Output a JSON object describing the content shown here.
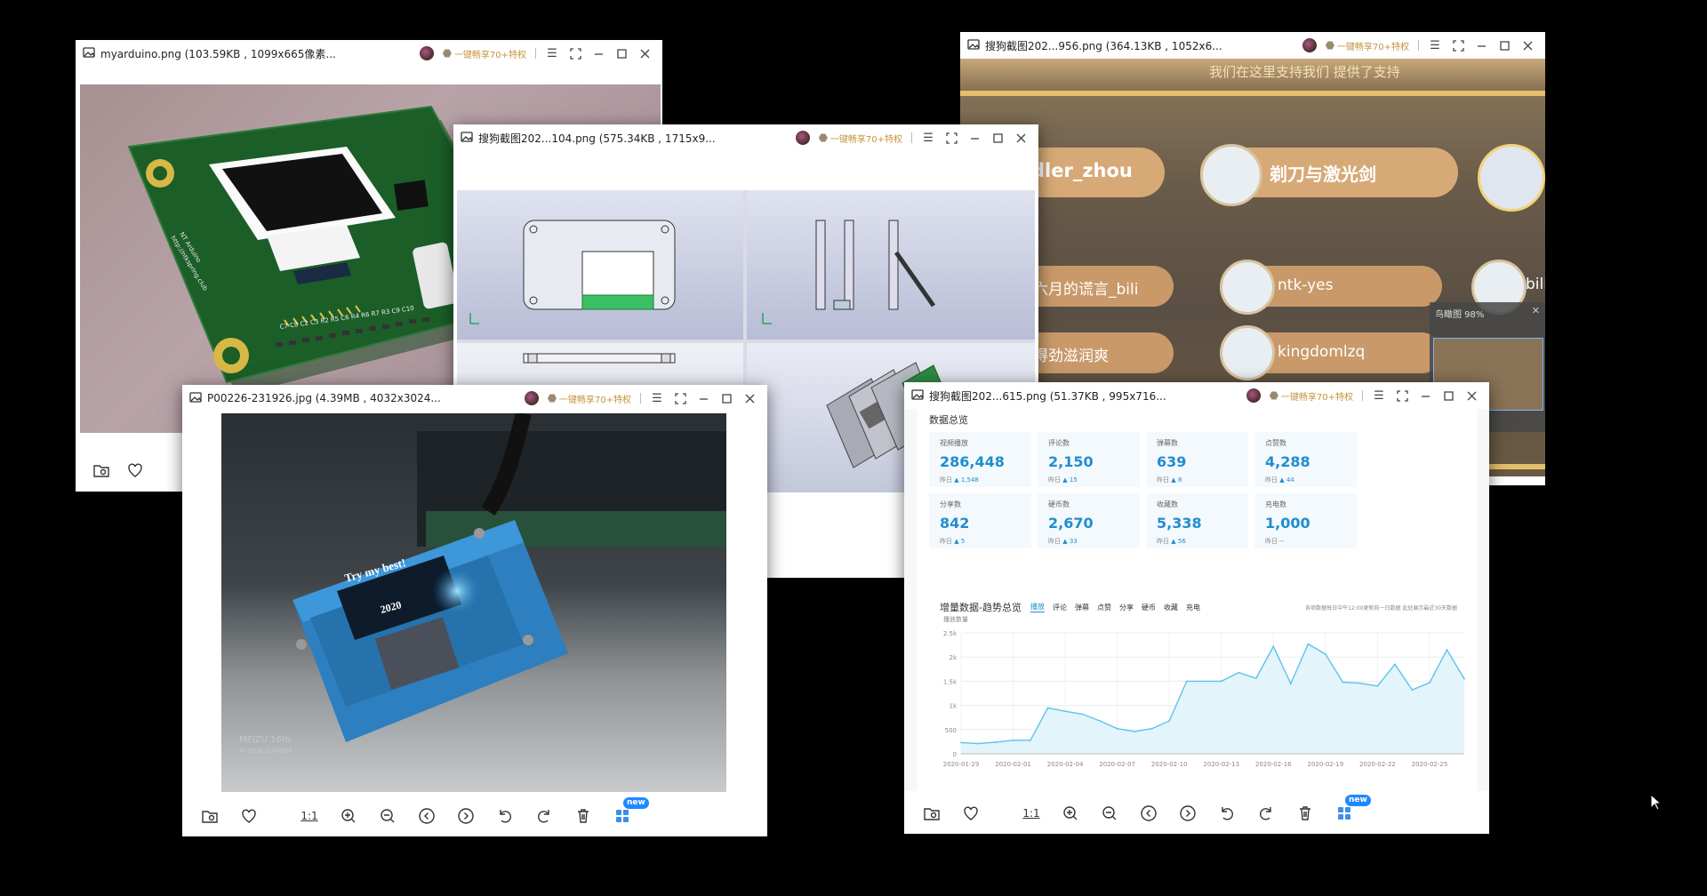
{
  "windows": {
    "w1": {
      "title": "myarduino.png (103.59KB , 1099x665像素..."
    },
    "w2": {
      "title": "搜狗截图202...104.png (575.34KB , 1715x9..."
    },
    "w3": {
      "title": "搜狗截图202...956.png (364.13KB , 1052x6..."
    },
    "w4": {
      "title": "P00226-231926.jpg (4.39MB , 4032x3024..."
    },
    "w5": {
      "title": "搜狗截图202...615.png (51.37KB , 995x716..."
    }
  },
  "promo_label": "一键畅享70+特权",
  "zoom_ratio_label": "1:1",
  "new_badge": "new",
  "pcb": {
    "brand_line1": "NT Arduino",
    "brand_line2": "http://ntkspring.club",
    "labels_row": "C7 C8 C2 C3 R2 R5 C6 R4 R6 R7 R3 C9 C10"
  },
  "photo_text": {
    "screen_line1": "Try my best!",
    "screen_line2": "2020",
    "watermark_line1": "MEIZU 16th",
    "watermark_line2": "AI DUAL CAMERA"
  },
  "bili": {
    "top_text": "我们在这里支持我们 提供了支持",
    "names": [
      "dler_zhou",
      "剃刀与激光剑",
      "六月的谎言_bili",
      "ntk-yes",
      "bili",
      "得劲滋润爽",
      "kingdomlzq"
    ],
    "minimap_label": "鸟瞰图 98%"
  },
  "dashboard": {
    "title": "数据总览",
    "cards": [
      {
        "label": "视频播放",
        "value": "286,448",
        "yesterday": "昨日",
        "delta": "▲ 1,548"
      },
      {
        "label": "评论数",
        "value": "2,150",
        "yesterday": "昨日",
        "delta": "▲ 15"
      },
      {
        "label": "弹幕数",
        "value": "639",
        "yesterday": "昨日",
        "delta": "▲ 8"
      },
      {
        "label": "点赞数",
        "value": "4,288",
        "yesterday": "昨日",
        "delta": "▲ 44"
      },
      {
        "label": "分享数",
        "value": "842",
        "yesterday": "昨日",
        "delta": "▲ 5"
      },
      {
        "label": "硬币数",
        "value": "2,670",
        "yesterday": "昨日",
        "delta": "▲ 33"
      },
      {
        "label": "收藏数",
        "value": "5,338",
        "yesterday": "昨日",
        "delta": "▲ 56"
      },
      {
        "label": "充电数",
        "value": "1,000",
        "yesterday": "昨日",
        "delta": "--"
      }
    ],
    "trend_title": "增量数据-趋势总览",
    "tabs": [
      "播放",
      "评论",
      "弹幕",
      "点赞",
      "分享",
      "硬币",
      "收藏",
      "充电"
    ],
    "active_tab": 0,
    "note": "各项数据每日中午12:00更新前一日数据   此处展示最近30天数据",
    "ylabel": "播放数量"
  },
  "chart_data": {
    "type": "area",
    "title": "增量数据-趋势总览",
    "ylabel": "播放数量",
    "ylim": [
      0,
      2500
    ],
    "yticks": [
      "0",
      "500",
      "1k",
      "1.5k",
      "2k",
      "2.5k"
    ],
    "ytick_values": [
      0,
      500,
      1000,
      1500,
      2000,
      2500
    ],
    "xtick_labels": [
      "2020-01-29",
      "2020-02-01",
      "2020-02-04",
      "2020-02-07",
      "2020-02-10",
      "2020-02-13",
      "2020-02-16",
      "2020-02-19",
      "2020-02-22",
      "2020-02-25"
    ],
    "series": [
      {
        "values": [
          230,
          210,
          240,
          280,
          280,
          950,
          880,
          820,
          680,
          520,
          460,
          520,
          680,
          1500,
          1500,
          1500,
          1680,
          1560,
          2220,
          1450,
          2270,
          2060,
          1480,
          1460,
          1400,
          1850,
          1320,
          1470,
          2150,
          1550
        ]
      }
    ],
    "color": "#5bc3ea",
    "grid": true
  },
  "colors": {
    "accent": "#1f8ecf",
    "promo": "#c4943c"
  }
}
